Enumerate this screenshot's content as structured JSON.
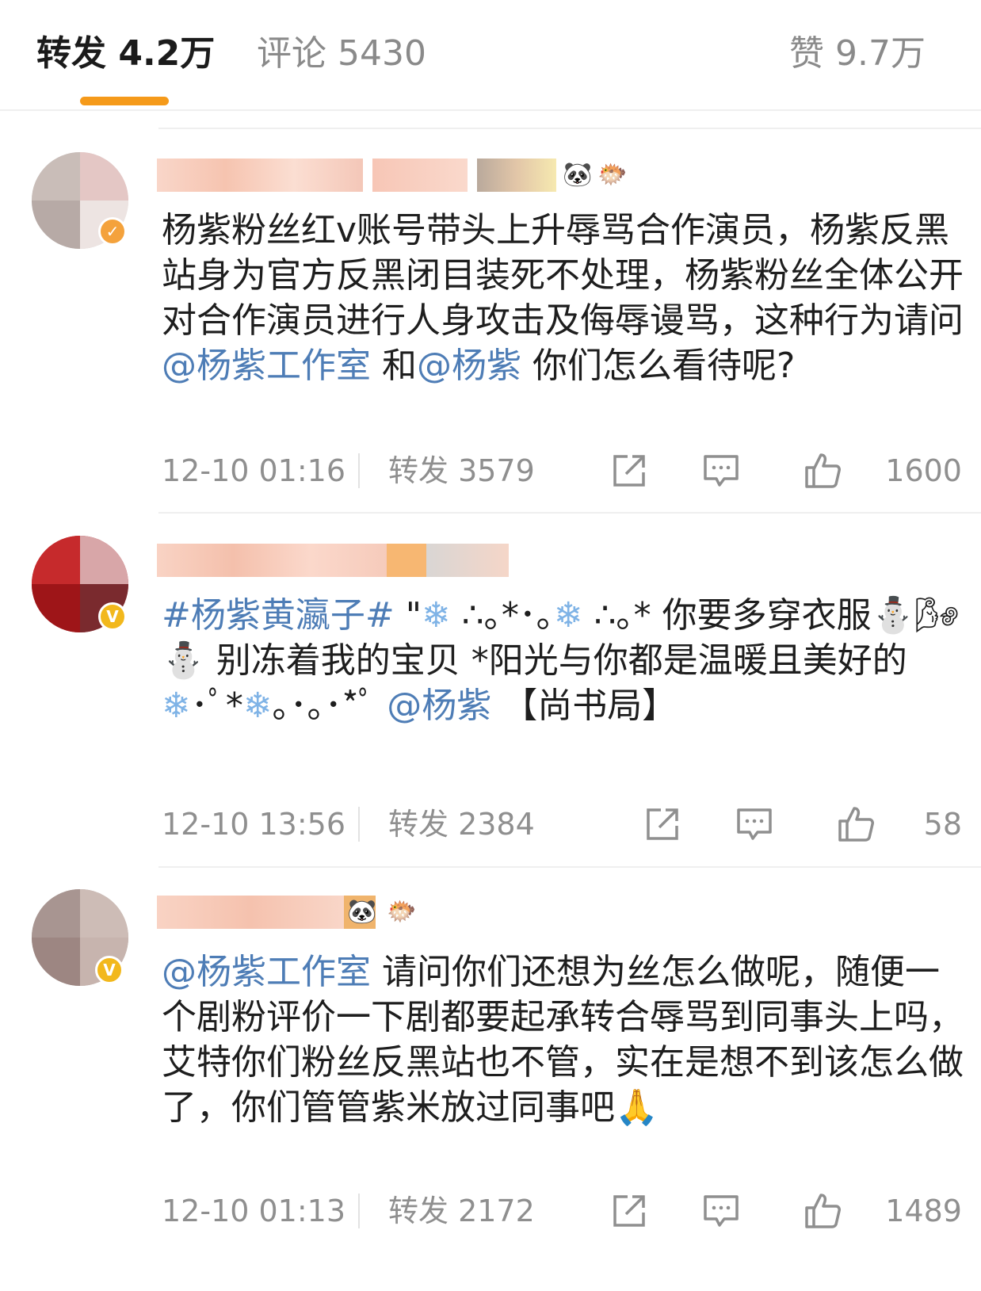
{
  "tabs": {
    "repost": {
      "label": "转发",
      "count": "4.2万"
    },
    "comments": {
      "label": "评论",
      "count": "5430"
    },
    "likes": {
      "label": "赞",
      "count": "9.7万"
    }
  },
  "accent_color": "#f59a1a",
  "mention_color": "#4e7db6",
  "comments": [
    {
      "segments": [
        {
          "t": "杨紫粉丝红v账号带头上升辱骂合作演员，杨紫反黑站身为官方反黑闭目装死不处理，杨紫粉丝全体公开对合作演员进行人身攻击及侮辱谩骂，这种行为请问"
        },
        {
          "t": "@杨紫工作室",
          "m": true
        },
        {
          "t": " 和"
        },
        {
          "t": "@杨紫",
          "m": true
        },
        {
          "t": " 你们怎么看待呢?"
        }
      ],
      "time": "12-10 01:16",
      "repost": "转发 3579",
      "likes": "1600"
    },
    {
      "segments": [
        {
          "t": "#杨紫黄瀛子#",
          "m": true
        },
        {
          "t": " \""
        },
        {
          "t": "❄",
          "s": true
        },
        {
          "t": " ∴｡*･｡"
        },
        {
          "t": "❄",
          "s": true
        },
        {
          "t": " ∴｡* 你要多穿衣服⛄🌬 ⛄  别冻着我的宝贝 *阳光与你都是温暖且美好的"
        },
        {
          "t": "❄",
          "s": true
        },
        {
          "t": "･ﾟ*"
        },
        {
          "t": "❄",
          "s": true
        },
        {
          "t": "｡･｡･*ﾟ "
        },
        {
          "t": "@杨紫",
          "m": true
        },
        {
          "t": " 【尚书局】"
        }
      ],
      "time": "12-10 13:56",
      "repost": "转发 2384",
      "likes": "58"
    },
    {
      "segments": [
        {
          "t": "@杨紫工作室",
          "m": true
        },
        {
          "t": " 请问你们还想为丝怎么做呢，随便一个剧粉评价一下剧都要起承转合辱骂到同事头上吗，艾特你们粉丝反黑站也不管，实在是想不到该怎么做了，你们管管紫米放过同事吧🙏"
        }
      ],
      "time": "12-10 01:13",
      "repost": "转发 2172",
      "likes": "1489"
    }
  ],
  "icons": [
    "share-icon",
    "comment-icon",
    "like-icon"
  ]
}
